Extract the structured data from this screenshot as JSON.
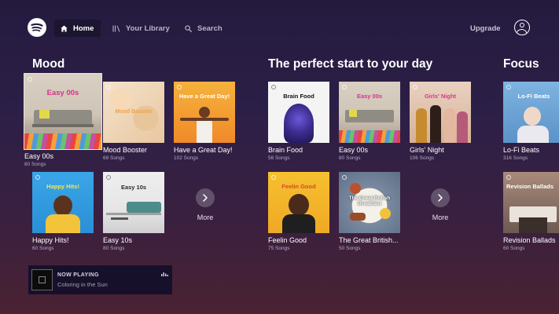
{
  "nav": {
    "home": "Home",
    "library": "Your Library",
    "search": "Search",
    "upgrade": "Upgrade"
  },
  "sections": {
    "mood": {
      "title": "Mood",
      "tiles": [
        {
          "title": "Easy 00s",
          "sub": "80 Songs",
          "cover_text": "Easy 00s"
        },
        {
          "title": "Mood Booster",
          "sub": "69 Songs",
          "cover_text": "Mood Booster"
        },
        {
          "title": "Have a Great Day!",
          "sub": "102 Songs",
          "cover_text": "Have a Great Day!"
        },
        {
          "title": "Happy Hits!",
          "sub": "60 Songs",
          "cover_text": "Happy Hits!"
        },
        {
          "title": "Easy 10s",
          "sub": "80 Songs",
          "cover_text": "Easy 10s"
        }
      ],
      "more": "More"
    },
    "perfect": {
      "title": "The perfect start to your day",
      "tiles": [
        {
          "title": "Brain Food",
          "sub": "56 Songs",
          "cover_text": "Brain Food"
        },
        {
          "title": "Easy 00s",
          "sub": "80 Songs",
          "cover_text": "Easy 00s"
        },
        {
          "title": "Girls' Night",
          "sub": "106 Songs",
          "cover_text": "Girls' Night"
        },
        {
          "title": "Feelin Good",
          "sub": "75 Songs",
          "cover_text": "Feelin Good"
        },
        {
          "title": "The Great British...",
          "sub": "50 Songs",
          "cover_text": "The Great British Breakfast"
        }
      ],
      "more": "More"
    },
    "focus": {
      "title": "Focus",
      "tiles": [
        {
          "title": "Lo-Fi Beats",
          "sub": "316 Songs",
          "cover_text": "Lo-Fi Beats"
        },
        {
          "title": "Revision Ballads",
          "sub": "60 Songs",
          "cover_text": "Revision Ballads"
        }
      ]
    }
  },
  "now_playing": {
    "label": "NOW PLAYING",
    "track": "Coloring in the Sun"
  },
  "colors": {
    "background_top": "#241a3e",
    "background_bottom": "#4a2232",
    "nav_active_bg": "#1c1530",
    "subtext": "#b3adc2"
  },
  "icons": [
    "spotify-logo-icon",
    "home-icon",
    "library-icon",
    "search-icon",
    "user-icon",
    "chevron-right-icon",
    "equalizer-icon"
  ]
}
